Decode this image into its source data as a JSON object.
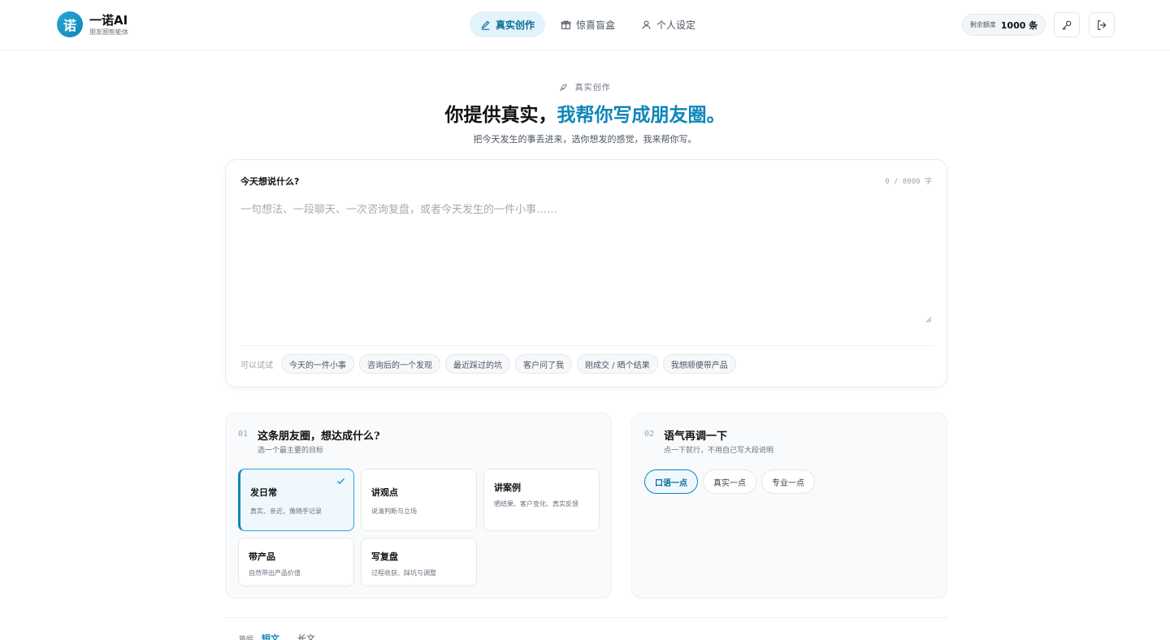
{
  "brand": {
    "logo_char": "诺",
    "name": "一诺AI",
    "subtitle": "朋友圈智能体"
  },
  "nav": [
    {
      "label": "真实创作",
      "icon": "pen-icon",
      "active": true
    },
    {
      "label": "惊喜盲盒",
      "icon": "gift-icon",
      "active": false
    },
    {
      "label": "个人设定",
      "icon": "user-icon",
      "active": false
    }
  ],
  "quota": {
    "label": "剩余额度",
    "value": "1000 条"
  },
  "header_icons": [
    "key-icon",
    "logout-icon"
  ],
  "hero": {
    "eyebrow": "真实创作",
    "title_main": "你提供真实，",
    "title_accent": "我帮你写成朋友圈。",
    "subtitle": "把今天发生的事丢进来，选你想发的感觉，我来帮你写。"
  },
  "composer": {
    "label": "今天想说什么?",
    "counter": "0 / 8000 字",
    "placeholder": "一句想法、一段聊天、一次咨询复盘，或者今天发生的一件小事……",
    "value": "",
    "suggest_label": "可以试试",
    "suggestions": [
      "今天的一件小事",
      "咨询后的一个发现",
      "最近踩过的坑",
      "客户问了我",
      "刚成交 / 晒个结果",
      "我想顺便带产品"
    ]
  },
  "goal_panel": {
    "step": "01",
    "title": "这条朋友圈，想达成什么?",
    "desc": "选一个最主要的目标",
    "options": [
      {
        "title": "发日常",
        "desc": "真实、亲近、像随手记录",
        "selected": true
      },
      {
        "title": "讲观点",
        "desc": "说清判断与立场",
        "selected": false
      },
      {
        "title": "讲案例",
        "desc": "晒结果、客户变化、真实反馈",
        "selected": false
      },
      {
        "title": "带产品",
        "desc": "自然带出产品价值",
        "selected": false
      },
      {
        "title": "写复盘",
        "desc": "过程收获、踩坑与调整",
        "selected": false
      }
    ]
  },
  "tone_panel": {
    "step": "02",
    "title": "语气再调一下",
    "desc": "点一下就行，不用自己写大段说明",
    "options": [
      {
        "label": "口语一点",
        "selected": true
      },
      {
        "label": "真实一点",
        "selected": false
      },
      {
        "label": "专业一点",
        "selected": false
      }
    ]
  },
  "length": {
    "label": "篇幅",
    "options": [
      {
        "label": "短文",
        "selected": true
      },
      {
        "label": "长文",
        "selected": false
      }
    ]
  },
  "colors": {
    "accent": "#0e86b8",
    "accent_light": "#e3f3fb",
    "text": "#111111",
    "muted": "#6b7280"
  }
}
